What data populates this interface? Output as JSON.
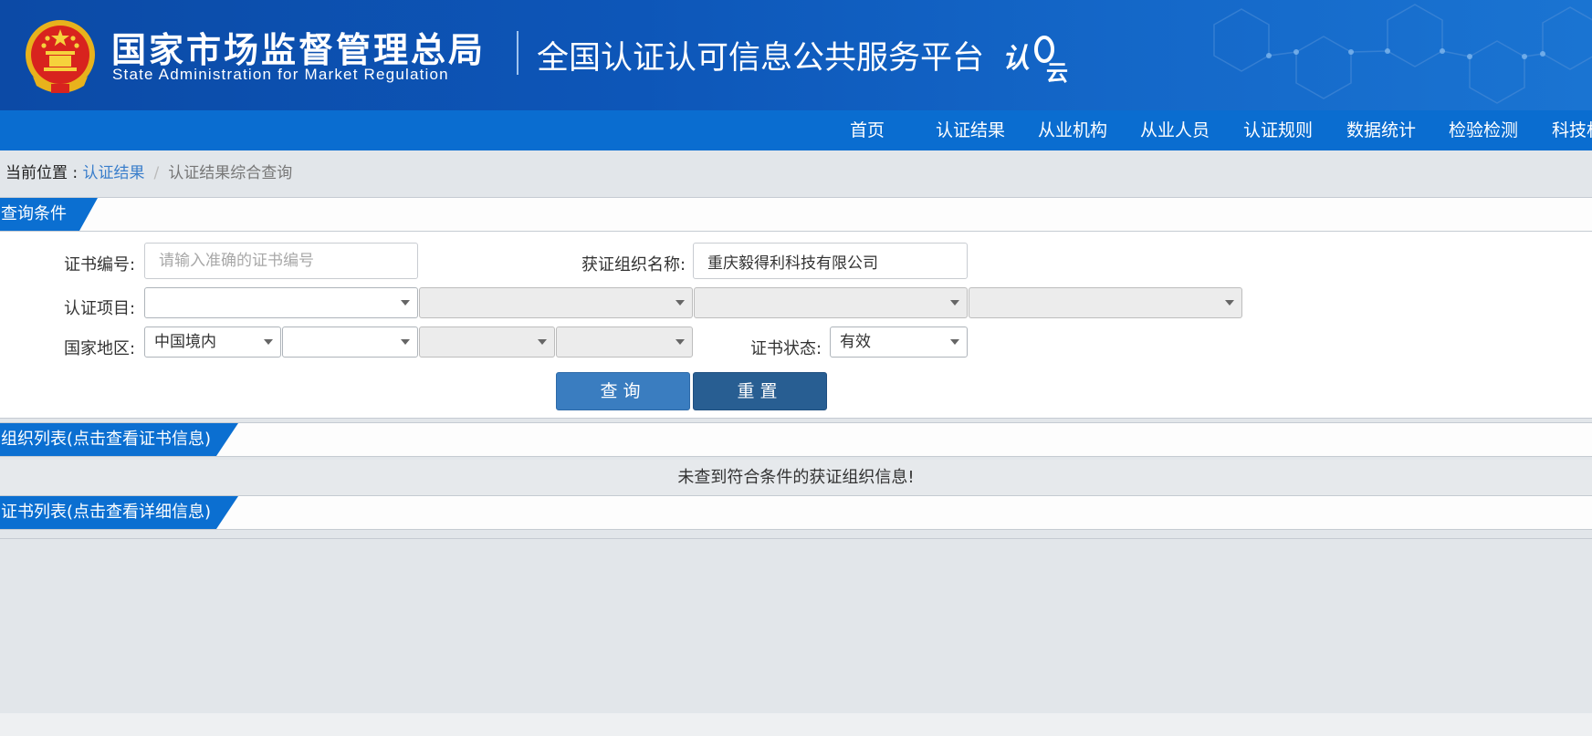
{
  "header": {
    "org_name_cn": "国家市场监督管理总局",
    "org_name_en": "State Administration  for  Market Regulation",
    "platform_title": "全国认证认可信息公共服务平台",
    "logo_text": "认云"
  },
  "nav": {
    "items": [
      {
        "label": "首页"
      },
      {
        "label": "认证结果"
      },
      {
        "label": "从业机构"
      },
      {
        "label": "从业人员"
      },
      {
        "label": "认证规则"
      },
      {
        "label": "数据统计"
      },
      {
        "label": "检验检测"
      },
      {
        "label": "科技机"
      }
    ]
  },
  "breadcrumb": {
    "label": "当前位置 : ",
    "link": "认证结果",
    "separator": "/",
    "current": "认证结果综合查询"
  },
  "query_section": {
    "title": "查询条件",
    "cert_no_label": "证书编号:",
    "cert_no_placeholder": "请输入准确的证书编号",
    "org_name_label": "获证组织名称:",
    "org_name_value": "重庆毅得利科技有限公司",
    "cert_project_label": "认证项目:",
    "region_label": "国家地区:",
    "region_value": "中国境内",
    "status_label": "证书状态:",
    "status_value": "有效",
    "query_button": "查询",
    "reset_button": "重置"
  },
  "org_list": {
    "title": "组织列表(点击查看证书信息)",
    "empty_message": "未查到符合条件的获证组织信息!"
  },
  "cert_list": {
    "title": "证书列表(点击查看详细信息)"
  },
  "colors": {
    "banner": "#0d56b8",
    "nav": "#0a6dd0",
    "section_tab": "#0b6fd1",
    "query_button": "#3a7dc0",
    "reset_button": "#285e92"
  }
}
